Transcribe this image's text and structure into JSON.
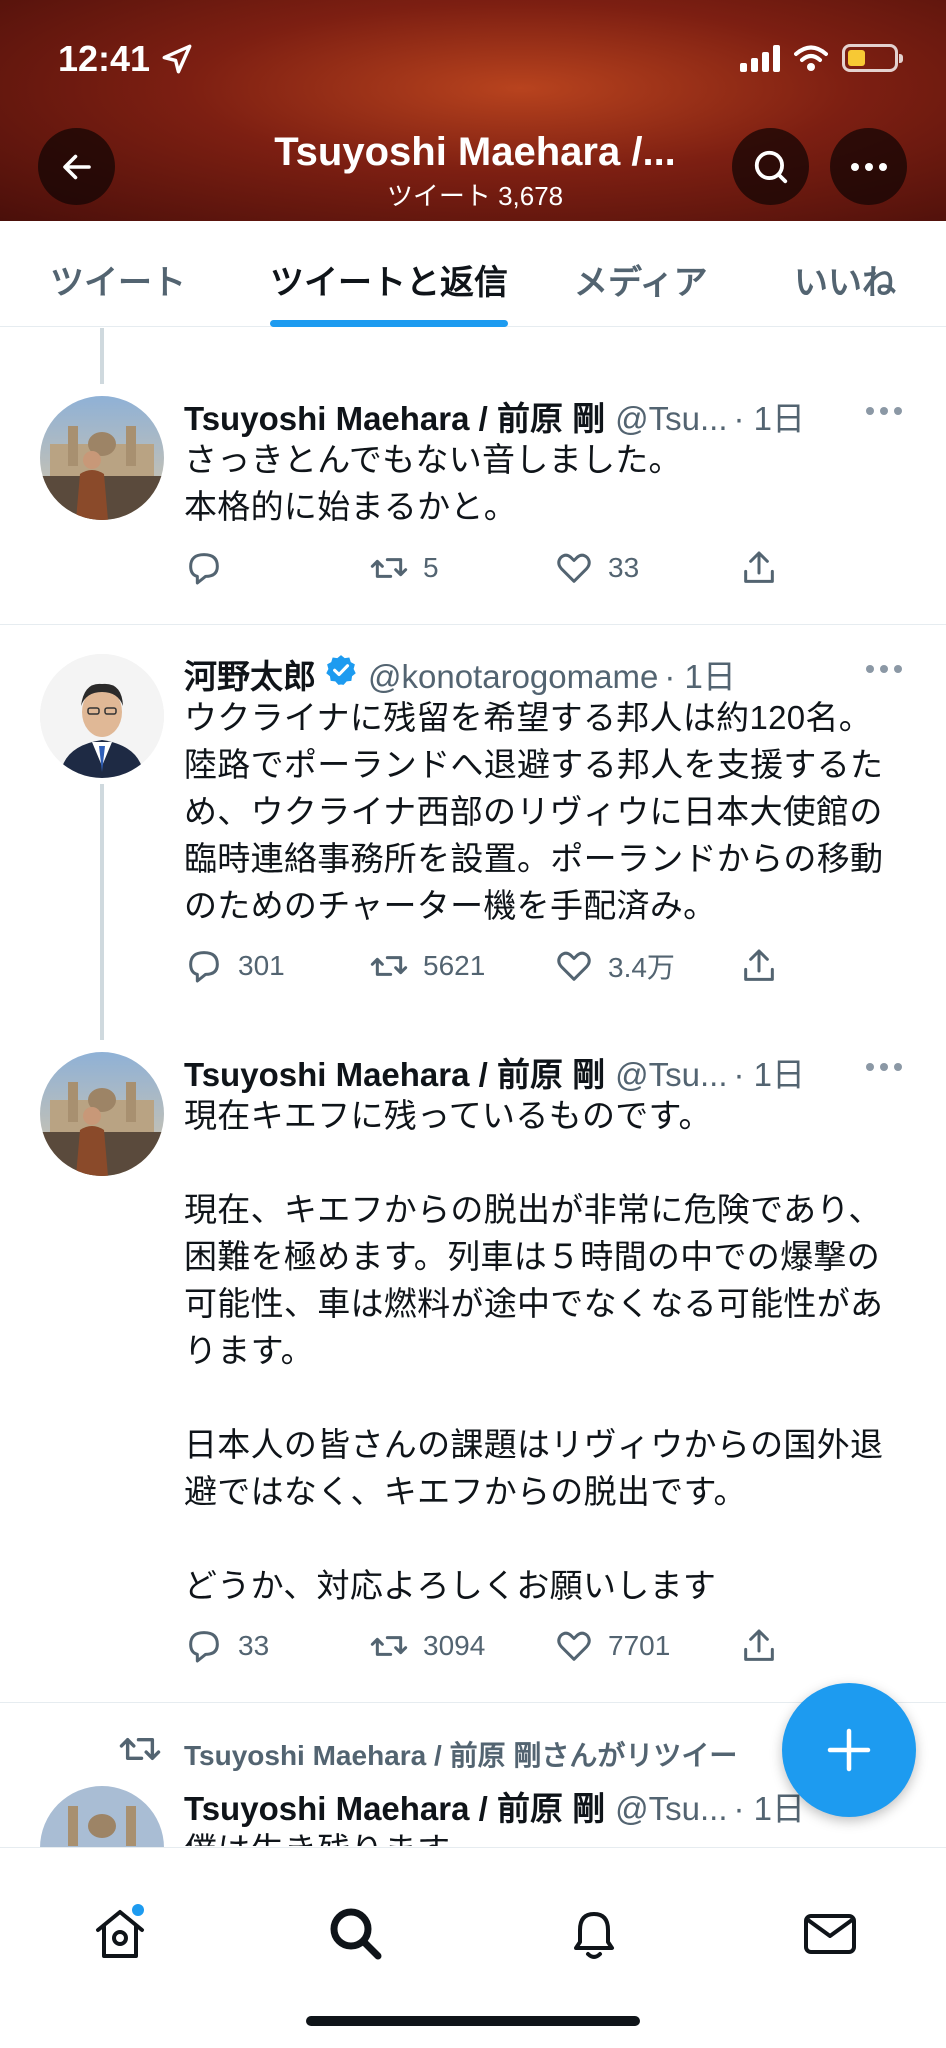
{
  "status_bar": {
    "time": "12:41"
  },
  "header": {
    "title": "Tsuyoshi Maehara /...",
    "subtitle": "ツイート 3,678"
  },
  "tabs": [
    {
      "label": "ツイート",
      "active": false
    },
    {
      "label": "ツイートと返信",
      "active": true
    },
    {
      "label": "メディア",
      "active": false
    },
    {
      "label": "いいね",
      "active": false
    }
  ],
  "tweets": [
    {
      "name": "Tsuyoshi Maehara / 前原 剛",
      "handle": "@Tsu...",
      "time": "· 1日",
      "text": "さっきとんでもない音しました。\n本格的に始まるかと。",
      "replies": "",
      "retweets": "5",
      "likes": "33"
    },
    {
      "name": "河野太郎",
      "verified": true,
      "handle": "@konotarogomame",
      "time": "· 1日",
      "text": "ウクライナに残留を希望する邦人は約120名。陸路でポーランドへ退避する邦人を支援するため、ウクライナ西部のリヴィウに日本大使館の臨時連絡事務所を設置。ポーランドからの移動のためのチャーター機を手配済み。",
      "replies": "301",
      "retweets": "5621",
      "likes": "3.4万"
    },
    {
      "name": "Tsuyoshi Maehara / 前原 剛",
      "handle": "@Tsu...",
      "time": "· 1日",
      "text": "現在キエフに残っているものです。\n\n現在、キエフからの脱出が非常に危険であり、困難を極めます。列車は５時間の中での爆撃の可能性、車は燃料が途中でなくなる可能性があります。\n\n日本人の皆さんの課題はリヴィウからの国外退避ではなく、キエフからの脱出です。\n\nどうか、対応よろしくお願いします",
      "replies": "33",
      "retweets": "3094",
      "likes": "7701"
    }
  ],
  "retweet_banner": {
    "label": "Tsuyoshi Maehara / 前原 剛さんがリツイー"
  },
  "partial_tweet": {
    "name": "Tsuyoshi Maehara / 前原 剛",
    "handle": "@Tsu...",
    "time": "· 1日",
    "text": "僕は生き残ります"
  },
  "colors": {
    "accent": "#1d9bf0",
    "header_bg": "#7d1f12",
    "battery": "#f7c934"
  },
  "icons": [
    "back-arrow-icon",
    "search-icon",
    "more-icon",
    "reply-icon",
    "retweet-icon",
    "like-icon",
    "share-icon",
    "compose-plus-icon",
    "home-icon",
    "explore-icon",
    "notifications-icon",
    "messages-icon"
  ]
}
